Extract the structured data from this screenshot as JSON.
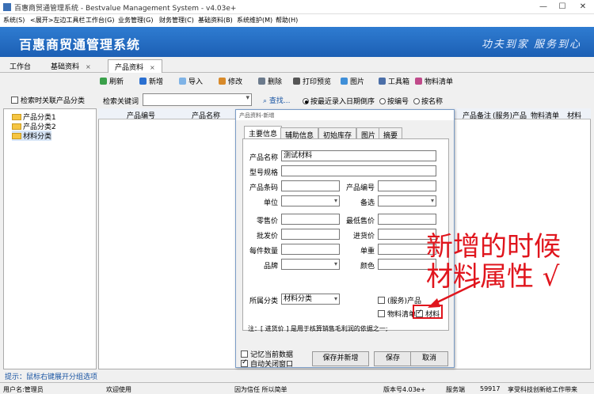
{
  "window": {
    "title": "百惠商贸通管理系统 - Bestvalue Management System - v4.03e+",
    "minimize": "—",
    "maximize": "☐",
    "close": "✕"
  },
  "menu": [
    "系统(S)",
    "<展开>左边工具栏",
    "工作台(G)",
    "业务管理(G)",
    "财务管理(C)",
    "基础资料(B)",
    "系统维护(M)",
    "帮助(H)"
  ],
  "banner": {
    "title": "百惠商贸通管理系统",
    "slogan": "功夫到家 服务到心"
  },
  "tabs": {
    "t1": "工作台",
    "t2": "基础资料",
    "t3": "产品资料",
    "close": "×"
  },
  "toolbar": {
    "refresh": "刷新",
    "add": "新增",
    "import": "导入",
    "edit": "修改",
    "delete": "删除",
    "print_preview": "打印预览",
    "image": "图片",
    "toolbox": "工具箱",
    "material_list": "物料清单"
  },
  "left": {
    "search_related": "检索时关联产品分类",
    "tree": [
      "产品分类1",
      "产品分类2",
      "材料分类"
    ],
    "hint": "提示：鼠标右键展开分组选项"
  },
  "search": {
    "label": "检索关键词",
    "button": "查找...",
    "radio_recent": "按最近录入日期倒序",
    "radio_code": "按编号",
    "radio_name": "按名称"
  },
  "grid": {
    "headers": [
      "产品编号",
      "产品名称",
      "产品备注",
      "(服务)产品",
      "物料清单",
      "材料"
    ]
  },
  "dialog": {
    "title": "产品资料-新增",
    "tabs": [
      "主要信息",
      "辅助信息",
      "初始库存",
      "图片",
      "摘要"
    ],
    "labels": {
      "name": "产品名称",
      "model": "型号规格",
      "barcode": "产品条码",
      "code": "产品编号",
      "unit": "单位",
      "backup": "备选",
      "retail": "零售价",
      "min_price": "最低售价",
      "wholesale": "批发价",
      "purchase": "进货价",
      "pack_qty": "每件数量",
      "weight": "单重",
      "brand": "品牌",
      "color": "颜色",
      "category": "所属分类"
    },
    "values": {
      "name": "测试材料",
      "category": "材料分类"
    },
    "checks": {
      "service": "(服务)产品",
      "bom": "物料清单",
      "material": "材料"
    },
    "note": "注：[ 进货价 ] 是用于核算销售毛利润的依据之一;",
    "remember": "记忆当前数据",
    "autoclose": "自动关闭窗口",
    "save_new": "保存并新增",
    "save": "保存",
    "cancel": "取消"
  },
  "annotation": {
    "line1": "新增的时候",
    "line2": "材料属性 √"
  },
  "status": {
    "user": "用户名:管理员",
    "welcome": "欢迎使用",
    "motto": "因为信任 所以简单",
    "version": "版本号4.03e+",
    "mode": "服务端",
    "code": "59917",
    "company": "享受科技创新给工作带来"
  }
}
